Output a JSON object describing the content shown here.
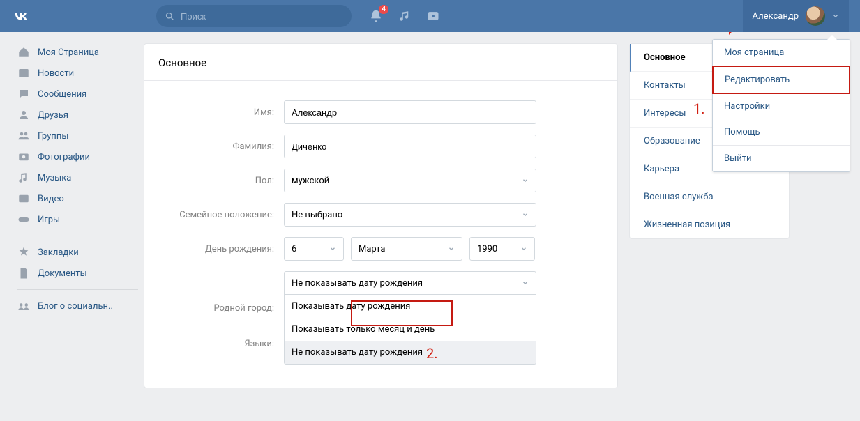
{
  "header": {
    "search_placeholder": "Поиск",
    "notif_count": "4",
    "user_name": "Александр"
  },
  "leftnav": {
    "items": [
      {
        "label": "Моя Страница",
        "icon": "home"
      },
      {
        "label": "Новости",
        "icon": "news"
      },
      {
        "label": "Сообщения",
        "icon": "messages"
      },
      {
        "label": "Друзья",
        "icon": "friends"
      },
      {
        "label": "Группы",
        "icon": "groups"
      },
      {
        "label": "Фотографии",
        "icon": "photos"
      },
      {
        "label": "Музыка",
        "icon": "music"
      },
      {
        "label": "Видео",
        "icon": "video"
      },
      {
        "label": "Игры",
        "icon": "games"
      }
    ],
    "secondary": [
      {
        "label": "Закладки",
        "icon": "bookmarks"
      },
      {
        "label": "Документы",
        "icon": "docs"
      }
    ],
    "tertiary": [
      {
        "label": "Блог о социальн..",
        "icon": "community"
      }
    ]
  },
  "main": {
    "title": "Основное",
    "labels": {
      "name": "Имя:",
      "surname": "Фамилия:",
      "gender": "Пол:",
      "marital": "Семейное положение:",
      "birthday": "День рождения:",
      "hometown": "Родной город:",
      "languages": "Языки:"
    },
    "values": {
      "name": "Александр",
      "surname": "Диченко",
      "gender": "мужской",
      "marital": "Не выбрано",
      "bday_day": "6",
      "bday_month": "Марта",
      "bday_year": "1990",
      "bvis_selected": "Не показывать дату рождения"
    },
    "bvis_options": [
      "Показывать дату рождения",
      "Показывать только месяц и день",
      "Не показывать дату рождения"
    ]
  },
  "rightnav": {
    "items": [
      "Основное",
      "Контакты",
      "Интересы",
      "Образование",
      "Карьера",
      "Военная служба",
      "Жизненная позиция"
    ]
  },
  "user_dd": {
    "items": [
      "Моя страница",
      "Редактировать",
      "Настройки",
      "Помощь",
      "Выйти"
    ]
  },
  "annotations": {
    "one": "1.",
    "two": "2."
  }
}
